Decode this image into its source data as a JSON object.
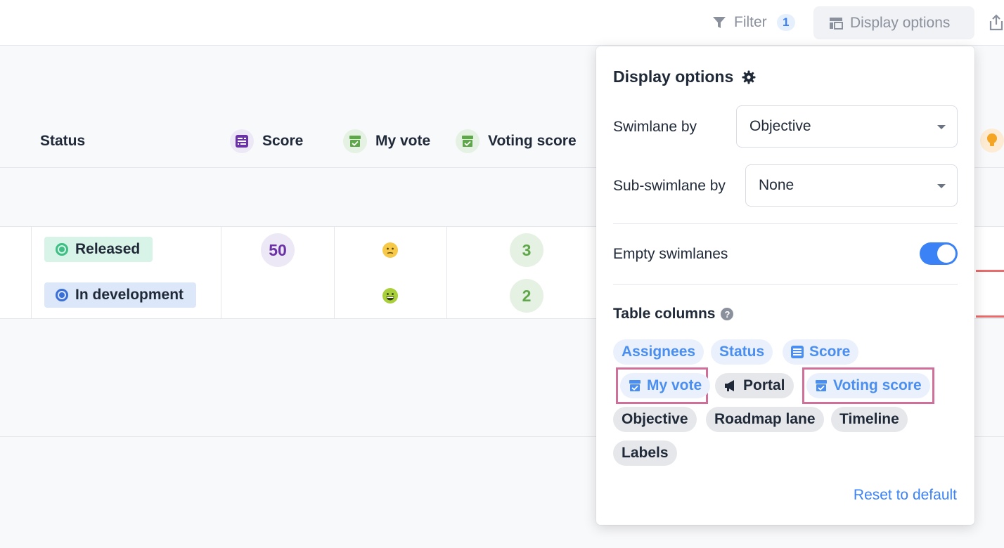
{
  "toolbar": {
    "filter_label": "Filter",
    "filter_count": "1",
    "display_options_label": "Display options"
  },
  "table": {
    "columns": {
      "status": "Status",
      "score": "Score",
      "my_vote": "My vote",
      "voting_score": "Voting score"
    },
    "rows": [
      {
        "status": "Released",
        "status_color": "#3fbf85",
        "score": "50",
        "my_vote_icon": "neutral-face-icon",
        "voting_score": "3"
      },
      {
        "status": "In development",
        "status_color": "#3b6fd8",
        "score": "",
        "my_vote_icon": "grinning-face-icon",
        "voting_score": "2"
      }
    ]
  },
  "display_options": {
    "title": "Display options",
    "swimlane_label": "Swimlane by",
    "swimlane_value": "Objective",
    "sub_swimlane_label": "Sub-swimlane by",
    "sub_swimlane_value": "None",
    "empty_swimlanes_label": "Empty swimlanes",
    "empty_swimlanes_on": true,
    "table_columns_label": "Table columns",
    "chips": [
      {
        "label": "Assignees",
        "active": true
      },
      {
        "label": "Status",
        "active": true
      },
      {
        "label": "Score",
        "active": true,
        "icon": "score-icon"
      },
      {
        "label": "My vote",
        "active": true,
        "icon": "ballot-icon",
        "highlighted": true
      },
      {
        "label": "Portal",
        "active": false,
        "icon": "megaphone-icon"
      },
      {
        "label": "Voting score",
        "active": true,
        "icon": "ballot-icon",
        "highlighted": true
      },
      {
        "label": "Objective",
        "active": false
      },
      {
        "label": "Roadmap lane",
        "active": false
      },
      {
        "label": "Timeline",
        "active": false
      },
      {
        "label": "Labels",
        "active": false
      }
    ],
    "reset_label": "Reset to default"
  },
  "colors": {
    "accent": "#3b82f6",
    "highlight": "#d0709a",
    "score_purple": "#6b32a8",
    "vote_green": "#5fa74a"
  }
}
